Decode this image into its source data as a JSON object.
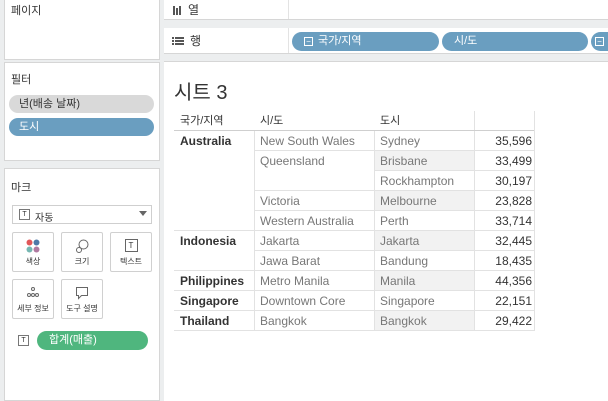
{
  "left": {
    "pages": {
      "title": "페이지"
    },
    "filters": {
      "title": "필터",
      "items": [
        "년(배송 날짜)",
        "도시"
      ]
    },
    "marks": {
      "title": "마크",
      "type": "자동",
      "buttons": [
        {
          "label": "색상",
          "icon": "color-icon"
        },
        {
          "label": "크기",
          "icon": "size-icon"
        },
        {
          "label": "텍스트",
          "icon": "text-icon"
        },
        {
          "label": "세부 정보",
          "icon": "detail-icon"
        },
        {
          "label": "도구 설명",
          "icon": "tooltip-icon"
        }
      ],
      "measure": "합계(매출)"
    }
  },
  "shelves": {
    "columns": {
      "label": "열"
    },
    "rows": {
      "label": "행",
      "pills": [
        "국가/지역",
        "시/도"
      ]
    }
  },
  "sheet": {
    "title": "시트 3",
    "headers": [
      "국가/지역",
      "시/도",
      "도시"
    ],
    "rows": [
      {
        "country": "Australia",
        "state": "New South Wales",
        "city": "Sydney",
        "value": "35,596"
      },
      {
        "country": "",
        "state": "Queensland",
        "city": "Brisbane",
        "value": "33,499"
      },
      {
        "country": "",
        "state": "",
        "city": "Rockhampton",
        "value": "30,197"
      },
      {
        "country": "",
        "state": "Victoria",
        "city": "Melbourne",
        "value": "23,828"
      },
      {
        "country": "",
        "state": "Western Australia",
        "city": "Perth",
        "value": "33,714"
      },
      {
        "country": "Indonesia",
        "state": "Jakarta",
        "city": "Jakarta",
        "value": "32,445"
      },
      {
        "country": "",
        "state": "Jawa Barat",
        "city": "Bandung",
        "value": "18,435"
      },
      {
        "country": "Philippines",
        "state": "Metro Manila",
        "city": "Manila",
        "value": "44,356"
      },
      {
        "country": "Singapore",
        "state": "Downtown Core",
        "city": "Singapore",
        "value": "22,151"
      },
      {
        "country": "Thailand",
        "state": "Bangkok",
        "city": "Bangkok",
        "value": "29,422"
      }
    ]
  }
}
